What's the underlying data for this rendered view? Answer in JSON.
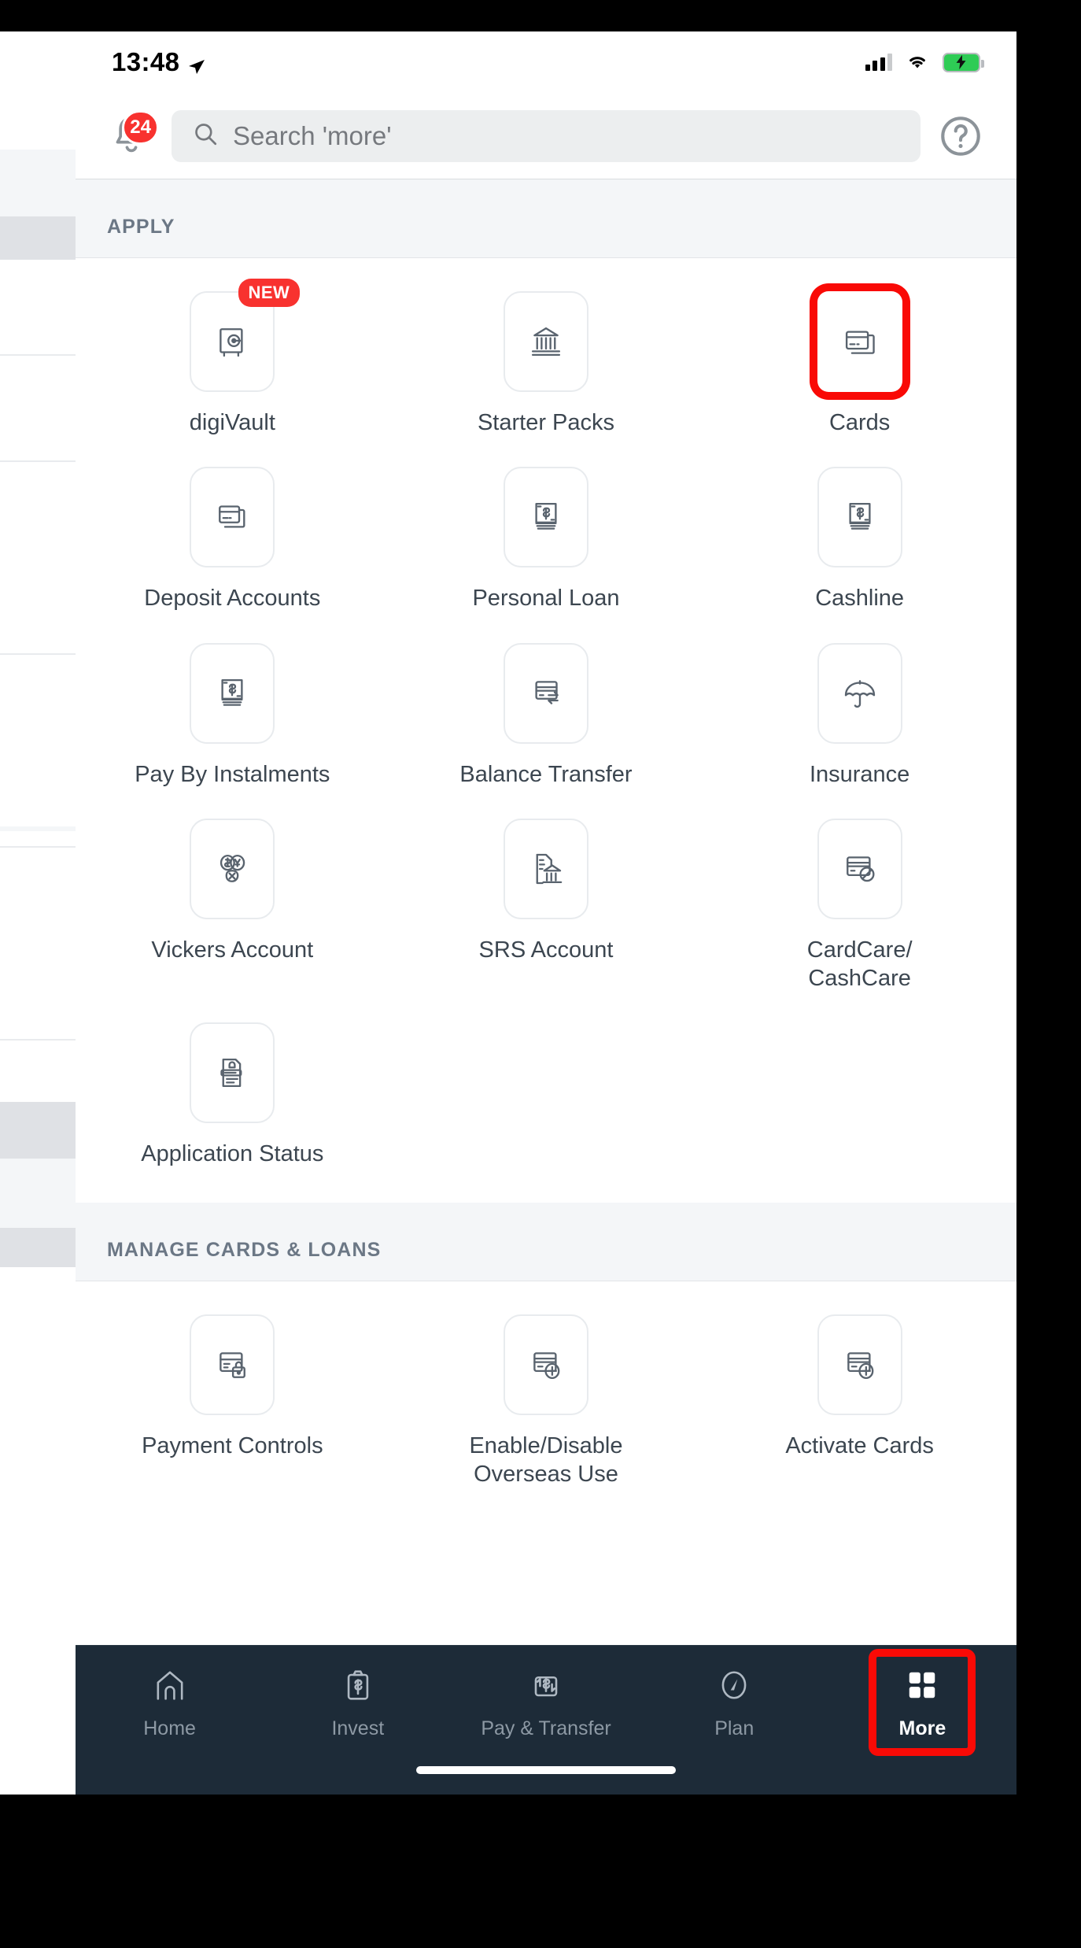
{
  "status_bar": {
    "time": "13:48",
    "location_icon": "location-arrow-icon",
    "signal_icon": "cellular-signal-icon",
    "signal_bars_filled": 3,
    "signal_bars_total": 4,
    "wifi_icon": "wifi-icon",
    "battery_icon": "battery-charging-icon",
    "battery_color": "#2ecc55"
  },
  "header": {
    "bell_icon": "notification-bell-icon",
    "notification_count": "24",
    "badge_color": "#f8322f",
    "search_icon": "search-icon",
    "search_value": "",
    "search_placeholder": "Search 'more'",
    "help_icon": "help-circle-icon"
  },
  "highlight_color": "#f90a06",
  "sections": [
    {
      "title": "APPLY",
      "items": [
        {
          "label": "digiVault",
          "icon": "vault-icon",
          "badge": "NEW",
          "highlighted": false
        },
        {
          "label": "Starter Packs",
          "icon": "bank-building-icon",
          "badge": "",
          "highlighted": false
        },
        {
          "label": "Cards",
          "icon": "credit-cards-icon",
          "badge": "",
          "highlighted": true
        },
        {
          "label": "Deposit Accounts",
          "icon": "stacked-cards-icon",
          "badge": "",
          "highlighted": false
        },
        {
          "label": "Personal Loan",
          "icon": "cash-note-icon",
          "badge": "",
          "highlighted": false
        },
        {
          "label": "Cashline",
          "icon": "cash-note-icon",
          "badge": "",
          "highlighted": false
        },
        {
          "label": "Pay By Instalments",
          "icon": "cash-note-icon",
          "badge": "",
          "highlighted": false
        },
        {
          "label": "Balance Transfer",
          "icon": "card-transfer-icon",
          "badge": "",
          "highlighted": false
        },
        {
          "label": "Insurance",
          "icon": "umbrella-icon",
          "badge": "",
          "highlighted": false
        },
        {
          "label": "Vickers Account",
          "icon": "currency-coins-icon",
          "badge": "",
          "highlighted": false
        },
        {
          "label": "SRS Account",
          "icon": "document-bank-icon",
          "badge": "",
          "highlighted": false
        },
        {
          "label": "CardCare/\nCashCare",
          "icon": "card-blocked-icon",
          "badge": "",
          "highlighted": false
        },
        {
          "label": "Application Status",
          "icon": "application-form-icon",
          "badge": "",
          "highlighted": false
        }
      ]
    },
    {
      "title": "MANAGE CARDS & LOANS",
      "items": [
        {
          "label": "Payment Controls",
          "icon": "card-lock-icon",
          "badge": "",
          "highlighted": false
        },
        {
          "label": "Enable/Disable\nOverseas Use",
          "icon": "card-plus-icon",
          "badge": "",
          "highlighted": false
        },
        {
          "label": "Activate Cards",
          "icon": "card-plus-icon",
          "badge": "",
          "highlighted": false
        }
      ]
    }
  ],
  "tabbar": [
    {
      "label": "Home",
      "icon": "home-icon",
      "active": false
    },
    {
      "label": "Invest",
      "icon": "money-bag-icon",
      "active": false
    },
    {
      "label": "Pay & Transfer",
      "icon": "transfer-icon",
      "active": false
    },
    {
      "label": "Plan",
      "icon": "compass-icon",
      "active": false
    },
    {
      "label": "More",
      "icon": "grid-squares-icon",
      "active": true
    }
  ]
}
